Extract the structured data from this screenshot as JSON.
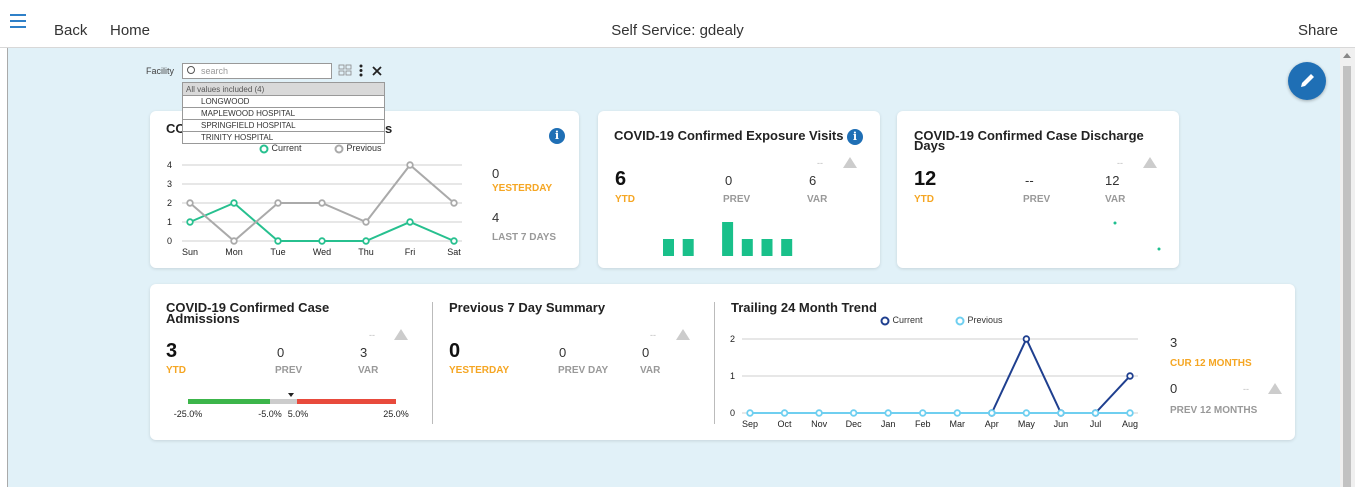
{
  "topbar": {
    "back": "Back",
    "home": "Home",
    "title": "Self Service: gdealy",
    "share": "Share"
  },
  "filter": {
    "label": "Facility",
    "placeholder": "search",
    "all_values": "All values included (4)",
    "options": [
      "LONGWOOD",
      "MAPLEWOOD HOSPITAL",
      "SPRINGFIELD HOSPITAL",
      "TRINITY HOSPITAL"
    ]
  },
  "card1": {
    "title_start": "CO",
    "title_end": "s",
    "legend_current": "Current",
    "legend_previous": "Previous",
    "yesterday_value": "0",
    "yesterday_label": "YESTERDAY",
    "last7_value": "4",
    "last7_label": "LAST 7 DAYS",
    "chart_data": {
      "type": "line",
      "categories": [
        "Sun",
        "Mon",
        "Tue",
        "Wed",
        "Thu",
        "Fri",
        "Sat"
      ],
      "yticks": [
        0,
        1,
        2,
        3,
        4
      ],
      "ylim": [
        0,
        4
      ],
      "series": [
        {
          "name": "Current",
          "color": "#27c08f",
          "values": [
            1,
            2,
            0,
            0,
            0,
            1,
            0
          ]
        },
        {
          "name": "Previous",
          "color": "#aaaaaa",
          "values": [
            2,
            0,
            2,
            2,
            1,
            4,
            2
          ]
        }
      ]
    }
  },
  "card2": {
    "title": "COVID-19 Confirmed Exposure Visits",
    "dash": "--",
    "ytd_value": "6",
    "ytd_label": "YTD",
    "prev_value": "0",
    "prev_label": "PREV",
    "var_value": "6",
    "var_label": "VAR",
    "sparkline": {
      "type": "bar",
      "values": [
        1,
        1,
        0,
        2,
        1,
        1,
        1
      ]
    }
  },
  "card3": {
    "title_line1": "COVID-19 Confirmed Case Discharge",
    "title_line2": "Days",
    "dash": "--",
    "ytd_value": "12",
    "ytd_label": "YTD",
    "prev_value": "--",
    "prev_label": "PREV",
    "var_value": "12",
    "var_label": "VAR"
  },
  "card4": {
    "title_line1": "COVID-19 Confirmed Case",
    "title_line2": "Admissions",
    "dash": "--",
    "ytd_value": "3",
    "ytd_label": "YTD",
    "prev_value": "0",
    "prev_label": "PREV",
    "var_value": "3",
    "var_label": "VAR",
    "gauge": {
      "ticks": [
        "-25.0%",
        "-5.0%",
        "5.0%",
        "25.0%"
      ],
      "colors": [
        "#3cb54a",
        "#cccccc",
        "#e84a3c"
      ]
    },
    "summary_title": "Previous 7 Day Summary",
    "summary_dash": "--",
    "yesterday_value": "0",
    "yesterday_label": "YESTERDAY",
    "prevday_value": "0",
    "prevday_label": "PREV DAY",
    "svar_value": "0",
    "svar_label": "VAR",
    "trend_title": "Trailing 24 Month Trend",
    "legend_current": "Current",
    "legend_previous": "Previous",
    "cur12_value": "3",
    "cur12_label": "CUR 12 MONTHS",
    "prev12_value": "0",
    "prev12_dash": "--",
    "prev12_label": "PREV 12 MONTHS",
    "chart_data": {
      "type": "line",
      "categories": [
        "Sep",
        "Oct",
        "Nov",
        "Dec",
        "Jan",
        "Feb",
        "Mar",
        "Apr",
        "May",
        "Jun",
        "Jul",
        "Aug"
      ],
      "yticks": [
        0,
        1,
        2
      ],
      "ylim": [
        0,
        2
      ],
      "series": [
        {
          "name": "Current",
          "color": "#1f3f8f",
          "values": [
            null,
            null,
            null,
            null,
            null,
            null,
            null,
            0,
            2,
            0,
            0,
            1
          ]
        },
        {
          "name": "Previous",
          "color": "#6fcff0",
          "values": [
            0,
            0,
            0,
            0,
            0,
            0,
            0,
            0,
            0,
            0,
            0,
            0
          ]
        }
      ]
    }
  }
}
